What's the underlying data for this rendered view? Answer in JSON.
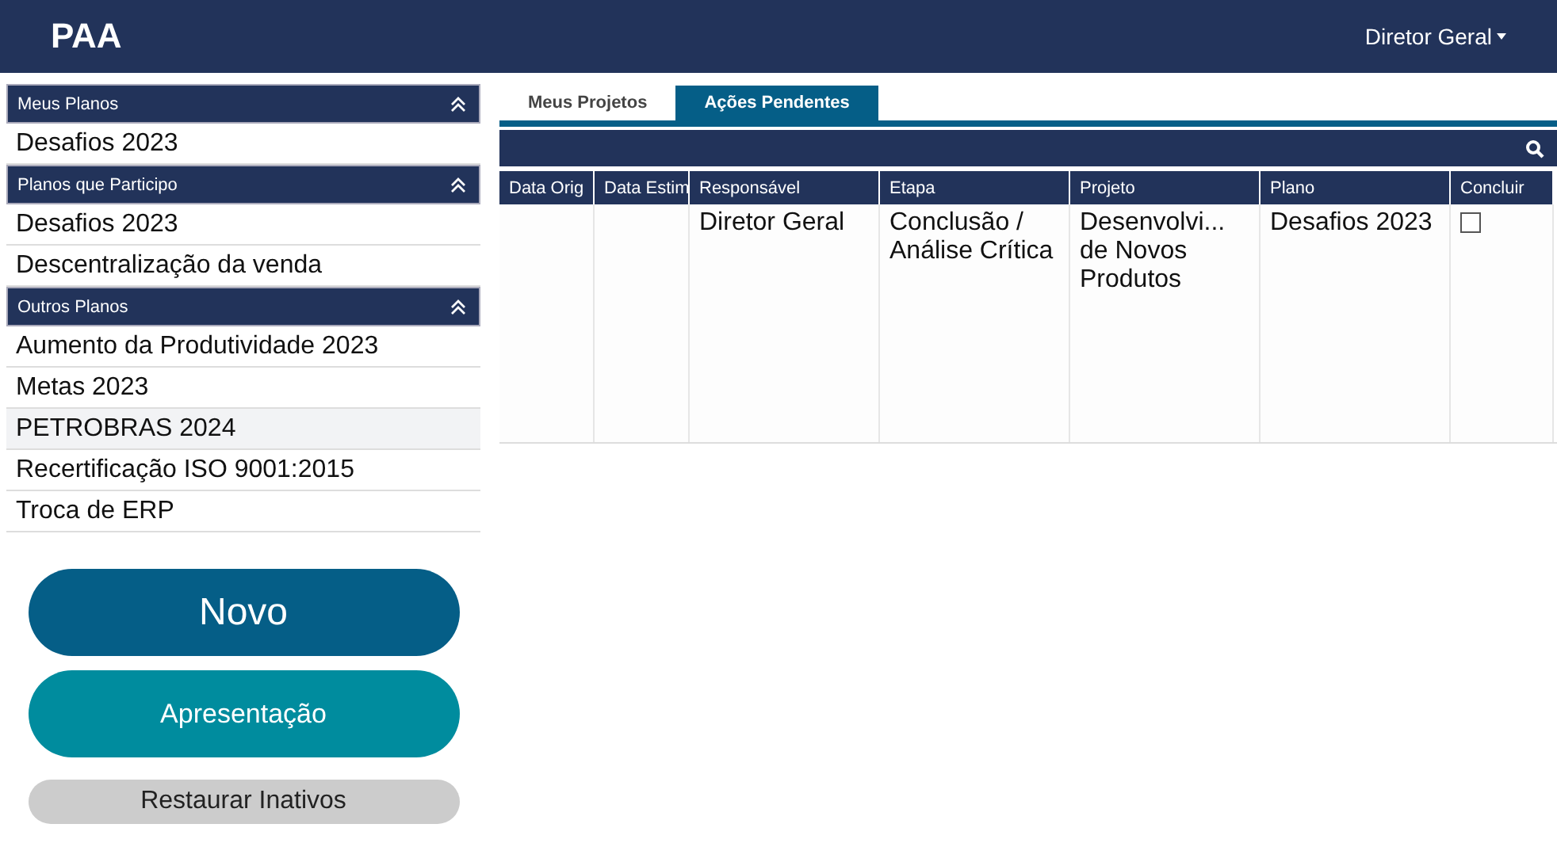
{
  "app": {
    "title": "PAA",
    "user_menu": "Diretor Geral"
  },
  "sidebar": {
    "sections": [
      {
        "title": "Meus Planos",
        "expanded": true,
        "items": [
          {
            "label": "Desafios 2023",
            "selected": false
          }
        ]
      },
      {
        "title": "Planos que Participo",
        "expanded": true,
        "items": [
          {
            "label": "Desafios 2023",
            "selected": false
          },
          {
            "label": "Descentralização da venda",
            "selected": false
          }
        ]
      },
      {
        "title": "Outros Planos",
        "expanded": true,
        "items": [
          {
            "label": "Aumento da Produtividade 2023",
            "selected": false
          },
          {
            "label": "Metas 2023",
            "selected": false
          },
          {
            "label": "PETROBRAS 2024",
            "selected": true
          },
          {
            "label": "Recertificação ISO 9001:2015",
            "selected": false
          },
          {
            "label": "Troca de ERP",
            "selected": false
          }
        ]
      }
    ]
  },
  "buttons": [
    {
      "label": "Novo",
      "kind": "primary"
    },
    {
      "label": "Apresentação",
      "kind": "secondary"
    },
    {
      "label": "Restaurar Inativos",
      "kind": "muted"
    }
  ],
  "tabs": [
    {
      "label": "Meus Projetos",
      "selected": false
    },
    {
      "label": "Ações Pendentes",
      "selected": true
    }
  ],
  "table": {
    "columns": [
      "Data Orig",
      "Data Estim",
      "Responsável",
      "Etapa",
      "Projeto",
      "Plano",
      "Concluir"
    ],
    "rows": [
      {
        "cells": [
          "",
          "",
          "Diretor Geral",
          "Conclusão / Análise Crítica",
          "Desenvolvi... de Novos Produtos",
          "Desafios 2023"
        ],
        "checked": false
      }
    ]
  }
}
